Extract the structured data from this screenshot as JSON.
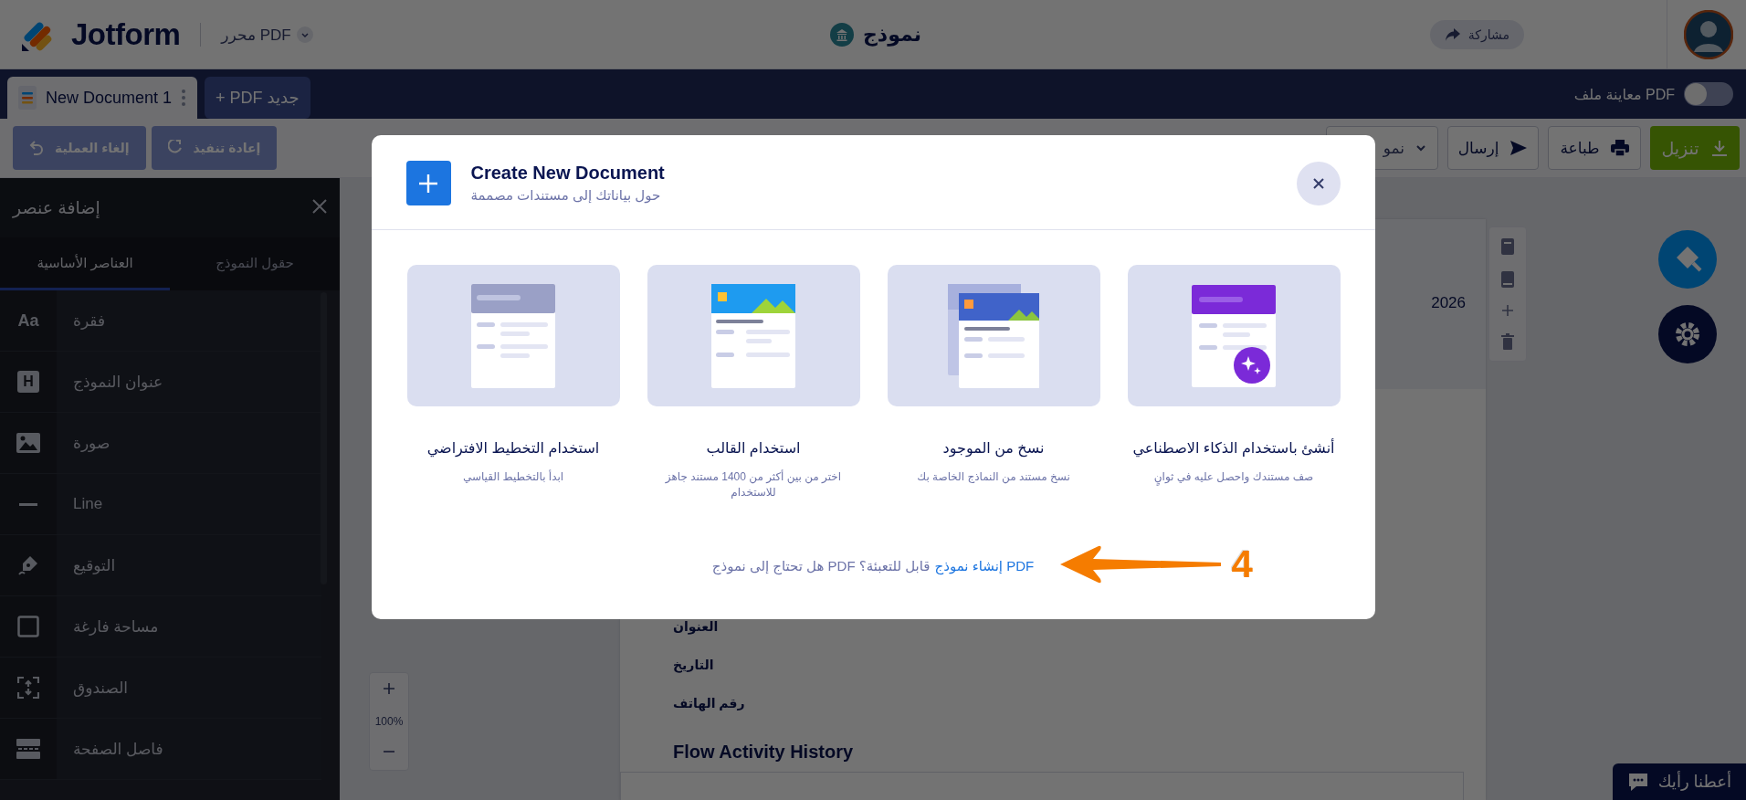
{
  "header": {
    "logo": "Jotform",
    "app_menu": "محرر PDF",
    "title": "نموذج",
    "share": "مشاركة"
  },
  "tabs": [
    {
      "label": "+ PDF جديد",
      "selected": false
    },
    {
      "label": "New Document 1",
      "selected": true
    }
  ],
  "preview_toggle": {
    "label": "معاينة ملف PDF",
    "on": false
  },
  "toolbar": {
    "left": [
      {
        "label": "إعادة تنفيذ",
        "disabled": true
      },
      {
        "label": "إلغاء العملية",
        "disabled": true
      }
    ],
    "right": [
      {
        "label": "تنزيل",
        "kind": "primary"
      },
      {
        "label": "طباعة",
        "kind": "outline"
      },
      {
        "label": "إرسال",
        "kind": "outline"
      },
      {
        "label": "نمو",
        "kind": "dropdown"
      }
    ]
  },
  "panel": {
    "title": "إضافة عنصر",
    "tabs": [
      {
        "label": "حقول النموذج",
        "selected": false
      },
      {
        "label": "العناصر الأساسية",
        "selected": true
      }
    ],
    "items": [
      {
        "glyph": "Aa",
        "label": "فقرة"
      },
      {
        "glyph": "H",
        "label": "عنوان النموذج"
      },
      {
        "label": "صورة"
      },
      {
        "label": "Line"
      },
      {
        "label": "التوقيع"
      },
      {
        "label": "مساحة فارغة"
      },
      {
        "label": "الصندوق"
      },
      {
        "label": "فاصل الصفحة"
      }
    ]
  },
  "document": {
    "date_fragment": "2026",
    "fields": [
      "العنوان",
      "التاريخ",
      "رقم الهاتف"
    ],
    "section_title": "Flow Activity History"
  },
  "zoom_value": "100%",
  "feedback": "أعطنا رأيك",
  "modal": {
    "title": "Create New Document",
    "subtitle": "حول بياناتك إلى مستندات مصممة",
    "options": [
      {
        "kind": "ai",
        "title": "أنشئ باستخدام الذكاء الاصطناعي",
        "description": "صف مستندك واحصل عليه في ثوانٍ"
      },
      {
        "kind": "copy",
        "title": "نسخ من الموجود",
        "description": "نسخ مستند من النماذج الخاصة بك"
      },
      {
        "kind": "template",
        "title": "استخدام القالب",
        "description": "اختر من بين أكثر من 1400 مستند جاهز للاستخدام"
      },
      {
        "kind": "blank",
        "title": "استخدام التخطيط الافتراضي",
        "description": "ابدأ بالتخطيط القياسي"
      }
    ],
    "prompt": "هل تحتاج إلى نموذج PDF قابل للتعبئة؟",
    "link": "إنشاء نموذج PDF"
  },
  "annotation": {
    "step": "4"
  }
}
